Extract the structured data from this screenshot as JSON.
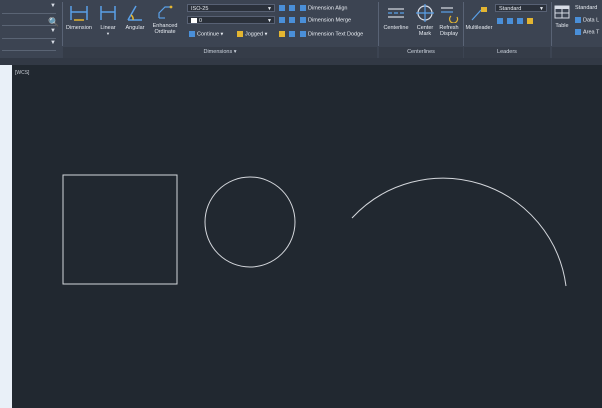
{
  "ribbon": {
    "dimension": "Dimension",
    "linear": "Linear",
    "angular": "Angular",
    "enhanced_ordinate": [
      "Enhanced",
      "Ordinate"
    ],
    "dim_style": "ISO-25",
    "layer_value": "0",
    "continue": "Continue",
    "jogged": "Jogged",
    "dimension_align": "Dimension Align",
    "dimension_merge": "Dimension Merge",
    "dimension_text_dodge": "Dimension Text Dodge",
    "dimensions_panel": "Dimensions",
    "centerline": "Centerline",
    "center_mark": [
      "Center",
      "Mark"
    ],
    "refresh_display": [
      "Refresh",
      "Display"
    ],
    "centerlines_panel": "Centerlines",
    "multileader": "Multileader",
    "leader_style": "Standard",
    "leaders_panel": "Leaders",
    "table": "Table",
    "table_style": "Standard",
    "data_link": "Data L",
    "area": "Area T"
  },
  "viewport": {
    "label": "[WCS]"
  },
  "colors": {
    "ribbon_bg": "#3c4452",
    "canvas_bg": "#212830",
    "accent_blue": "#4a8fd8",
    "shape_stroke": "#d4d7dc"
  },
  "icons": {
    "dimension": "dimension-icon",
    "linear": "linear-dimension-icon",
    "angular": "angular-dimension-icon",
    "ordinate": "ordinate-dimension-icon",
    "centerline": "centerline-icon",
    "center_mark": "center-mark-icon",
    "refresh": "refresh-display-icon",
    "multileader": "multileader-icon",
    "table": "table-icon",
    "search": "search-icon"
  }
}
